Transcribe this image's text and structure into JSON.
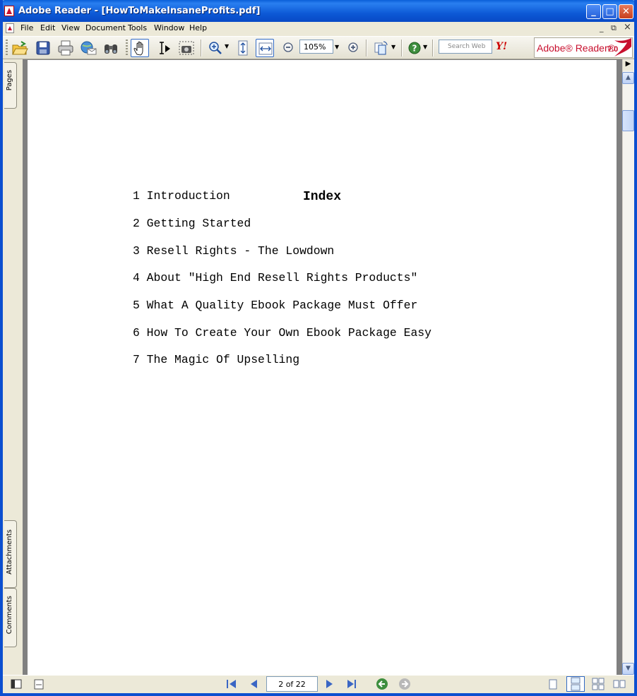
{
  "window": {
    "title": "Adobe Reader - [HowToMakeInsaneProfits.pdf]",
    "controls": {
      "minimize": "_",
      "maximize": "□",
      "close": "✕"
    }
  },
  "menu": [
    "File",
    "Edit",
    "View",
    "Document",
    "Tools",
    "Window",
    "Help"
  ],
  "doc_window_controls": {
    "minimize": "_",
    "restore": "⧉",
    "close": "×"
  },
  "toolbar": {
    "zoom_value": "105%",
    "search_placeholder": "Search Web",
    "yahoo_label": "Y!",
    "brand": "Adobe® Reader®",
    "version": "7.0"
  },
  "side_tabs": {
    "pages": "Pages",
    "attachments": "Attachments",
    "comments": "Comments"
  },
  "document": {
    "title": "Index",
    "toc": [
      "1 Introduction",
      "2 Getting Started",
      "3 Resell Rights - The Lowdown",
      "4 About \"High End Resell Rights Products\"",
      "5 What A Quality Ebook Package Must Offer",
      "6 How To Create Your Own Ebook Package Easy",
      "7 The Magic Of Upselling"
    ]
  },
  "status": {
    "page_indicator": "2 of 22"
  },
  "colors": {
    "titlebar": "#0a5fd8",
    "brand_red": "#c8102e",
    "workspace": "#808080"
  }
}
